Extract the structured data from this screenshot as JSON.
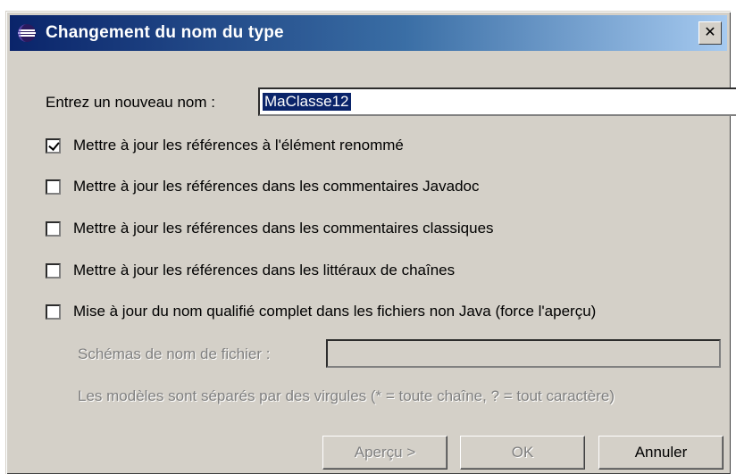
{
  "dialog": {
    "title": "Changement du nom du type",
    "close_glyph": "✕",
    "icon": "eclipse-icon"
  },
  "name": {
    "label": "Entrez un nouveau nom :",
    "value": "MaClasse12"
  },
  "options": [
    {
      "label": "Mettre à jour les références à l'élément renommé",
      "checked": true
    },
    {
      "label": "Mettre à jour les références dans les commentaires Javadoc",
      "checked": false
    },
    {
      "label": "Mettre à jour les références dans les commentaires classiques",
      "checked": false
    },
    {
      "label": "Mettre à jour les références dans les littéraux de chaînes",
      "checked": false
    },
    {
      "label": "Mise à jour du nom qualifié complet dans les fichiers non Java (force l'aperçu)",
      "checked": false
    }
  ],
  "patterns": {
    "label": "Schémas de nom de fichier :",
    "value": "",
    "hint": "Les modèles sont séparés par des virgules (* = toute chaîne, ? = tout caractère)"
  },
  "buttons": {
    "preview": "Aperçu >",
    "ok": "OK",
    "cancel": "Annuler"
  },
  "colors": {
    "title_start": "#0a246a",
    "title_end": "#a6caf0",
    "face": "#d4d0c8",
    "disabled_text": "#808080"
  }
}
